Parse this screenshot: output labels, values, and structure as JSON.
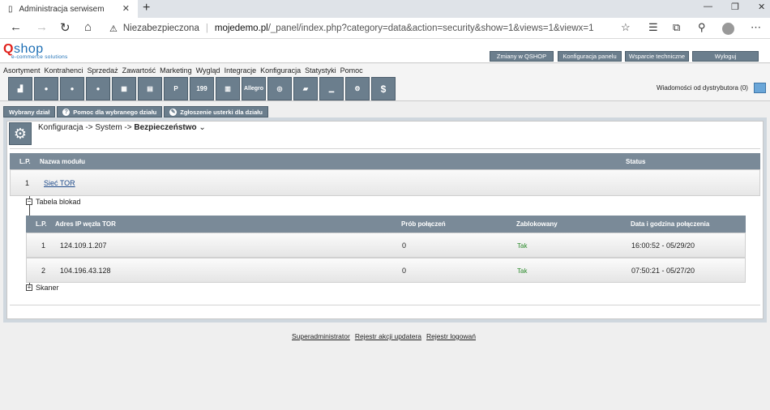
{
  "browser": {
    "tab_title": "Administracja serwisem",
    "security": "Niezabezpieczona",
    "url_host": "mojedemo.pl",
    "url_path": "/_panel/index.php?category=data&action=security&show=1&views=1&viewx=1"
  },
  "brand": {
    "logo": "shop",
    "logo_q": "Q",
    "tagline": "e-commerce solutions"
  },
  "header_buttons": [
    "Zmiany w QSHOP",
    "Konfiguracja panelu",
    "Wsparcie techniczne",
    "Wyloguj"
  ],
  "menu": [
    "Asortyment",
    "Kontrahenci",
    "Sprzedaż",
    "Zawartość",
    "Marketing",
    "Wygląd",
    "Integracje",
    "Konfiguracja",
    "Statystyki",
    "Pomoc"
  ],
  "toolbar_icons": [
    {
      "icon": "chart-icon",
      "label": ""
    },
    {
      "icon": "user-icon",
      "label": ""
    },
    {
      "icon": "users-icon",
      "label": ""
    },
    {
      "icon": "contact-icon",
      "label": ""
    },
    {
      "icon": "grid-icon",
      "label": ""
    },
    {
      "icon": "document-icon",
      "label": ""
    },
    {
      "icon": "page-p-icon",
      "label": "P"
    },
    {
      "icon": "price-199-icon",
      "label": "199"
    },
    {
      "icon": "layout-icon",
      "label": ""
    },
    {
      "icon": "allegro-icon",
      "label": "Allegro"
    },
    {
      "icon": "disc-icon",
      "label": ""
    },
    {
      "icon": "folder-icon",
      "label": ""
    },
    {
      "icon": "graph-icon",
      "label": ""
    },
    {
      "icon": "settings-icon",
      "label": ""
    },
    {
      "icon": "finance-icon",
      "label": "$"
    }
  ],
  "messages": "Wiadomości od dystrybutora (0)",
  "section_tabs": [
    "Wybrany dział",
    "Pomoc dla wybranego działu",
    "Zgłoszenie usterki dla działu"
  ],
  "breadcrumb": {
    "path": "Konfiguracja -> System -> ",
    "current": "Bezpieczeństwo"
  },
  "modules_table": {
    "headers": [
      "L.P.",
      "Nazwa modułu",
      "Status"
    ],
    "rows": [
      {
        "lp": "1",
        "name": "Sieć TOR",
        "status": ""
      }
    ]
  },
  "blocks_label": "Tabela blokad",
  "blocks_table": {
    "headers": [
      "L.P.",
      "Adres IP węzła TOR",
      "Prób połączeń",
      "Zablokowany",
      "Data i godzina połączenia"
    ],
    "rows": [
      {
        "lp": "1",
        "ip": "124.109.1.207",
        "attempts": "0",
        "blocked": "Tak",
        "datetime": "16:00:52 - 05/29/20"
      },
      {
        "lp": "2",
        "ip": "104.196.43.128",
        "attempts": "0",
        "blocked": "Tak",
        "datetime": "07:50:21 - 05/27/20"
      }
    ]
  },
  "scanner_label": "Skaner",
  "footer_links": [
    "Superadministrator",
    "Rejestr akcji updatera",
    "Rejestr logowań"
  ]
}
